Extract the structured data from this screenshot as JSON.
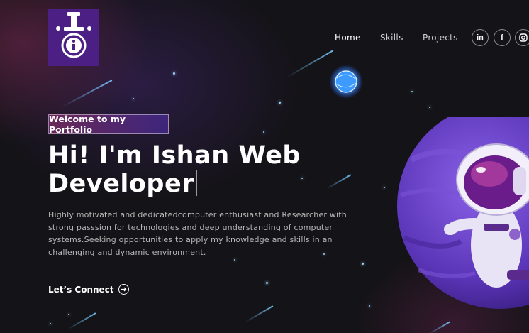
{
  "logo": {
    "icon": "portfolio-logo-icon",
    "color": "#4b1f83"
  },
  "nav": {
    "links": [
      {
        "label": "Home",
        "active": true
      },
      {
        "label": "Skills",
        "active": false
      },
      {
        "label": "Projects",
        "active": false
      }
    ],
    "social": [
      {
        "label": "in",
        "icon": "linkedin-icon"
      },
      {
        "label": "f",
        "icon": "facebook-icon"
      },
      {
        "label": "",
        "icon": "instagram-icon"
      }
    ]
  },
  "hero": {
    "badge": "Welcome to my Portfolio",
    "headline": "Hi! I'm Ishan Web Developer",
    "description": "Highly motivated and dedicatedcomputer enthusiast and Researcher with strong passsion for technologies and deep understanding of computer systems.Seeking opportunities to apply my knowledge and skills in an challenging and dynamic environment.",
    "cta": "Let’s Connect"
  },
  "colors": {
    "accent_pink": "#aa367c",
    "accent_purple": "#4a2fbd",
    "background": "#121212"
  },
  "illustrations": {
    "planet": "planet-illustration",
    "astronaut": "astronaut-illustration",
    "orb": "glowing-orb-illustration"
  }
}
